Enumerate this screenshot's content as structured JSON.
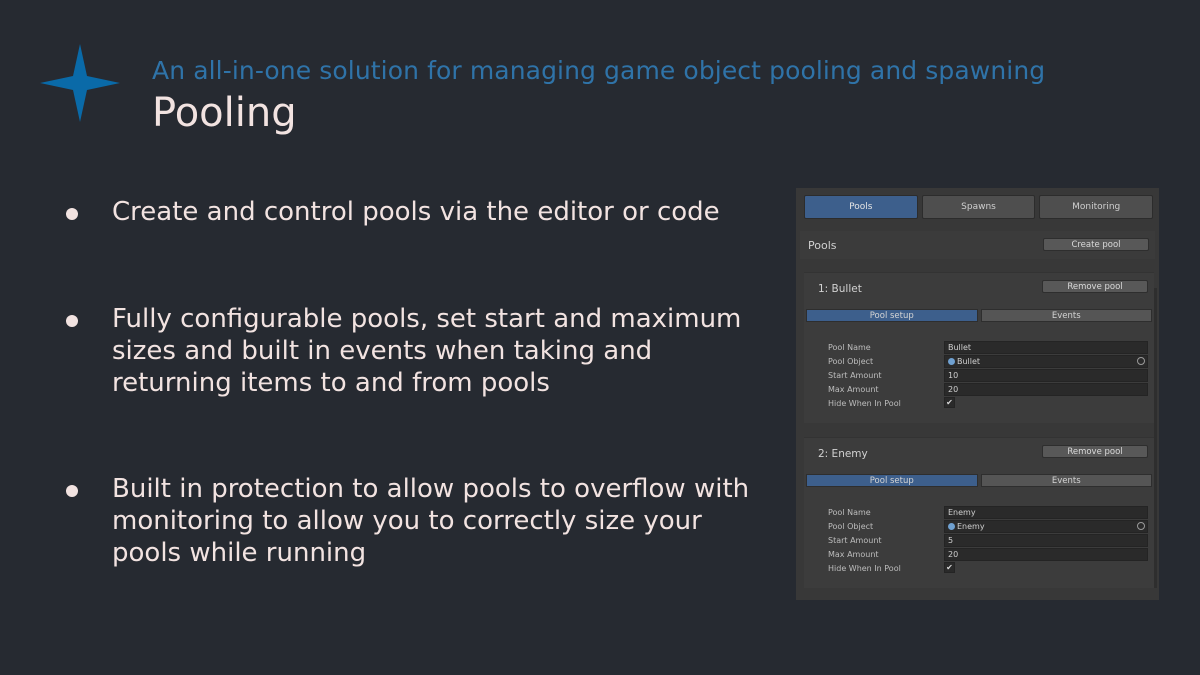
{
  "header": {
    "subtitle": "An all-in-one solution for managing game object pooling and spawning",
    "title": "Pooling",
    "logo_color": "#0a6aa8"
  },
  "bullets": [
    "Create and control pools via the editor or code",
    "Fully configurable pools, set start and maximum sizes and built in events when taking and returning items to and from pools",
    "Built in protection to allow pools to overflow with monitoring to allow you to correctly size your pools while running"
  ],
  "inspector": {
    "tabs": [
      "Pools",
      "Spawns",
      "Monitoring"
    ],
    "section_label": "Pools",
    "create_button": "Create pool",
    "pools": [
      {
        "header": "1: Bullet",
        "remove_button": "Remove pool",
        "subtabs": [
          "Pool setup",
          "Events"
        ],
        "fields": {
          "pool_name_label": "Pool Name",
          "pool_name": "Bullet",
          "pool_object_label": "Pool Object",
          "pool_object": "Bullet",
          "start_amount_label": "Start Amount",
          "start_amount": "10",
          "max_amount_label": "Max Amount",
          "max_amount": "20",
          "hide_label": "Hide When In Pool",
          "hide_check": "✔"
        }
      },
      {
        "header": "2: Enemy",
        "remove_button": "Remove pool",
        "subtabs": [
          "Pool setup",
          "Events"
        ],
        "fields": {
          "pool_name_label": "Pool Name",
          "pool_name": "Enemy",
          "pool_object_label": "Pool Object",
          "pool_object": "Enemy",
          "start_amount_label": "Start Amount",
          "start_amount": "5",
          "max_amount_label": "Max Amount",
          "max_amount": "20",
          "hide_label": "Hide When In Pool",
          "hide_check": "✔"
        }
      }
    ]
  }
}
